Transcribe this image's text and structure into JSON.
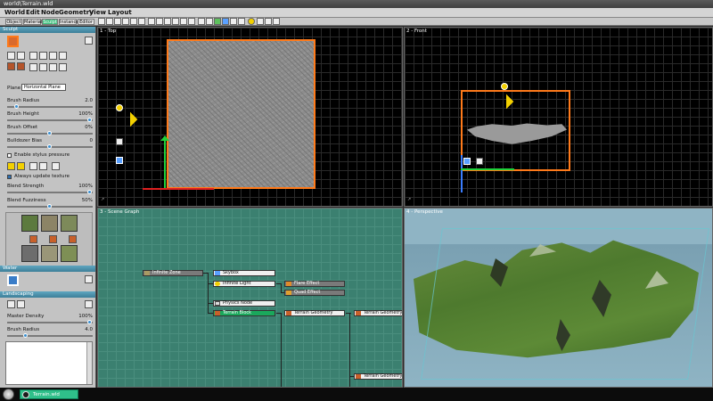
{
  "window": {
    "title": "world\\Terrain.wld"
  },
  "menu": [
    "World",
    "Edit",
    "Node",
    "Geometry",
    "View",
    "Layout"
  ],
  "tabs": [
    {
      "label": "Object",
      "active": false
    },
    {
      "label": "Material",
      "active": false
    },
    {
      "label": "Sculpt",
      "active": true
    },
    {
      "label": "Instance",
      "active": false
    },
    {
      "label": "Editor",
      "active": false
    }
  ],
  "sidebar": {
    "sculpt_header": "Sculpt",
    "plane_label": "Plane",
    "plane_value": "Horizontal Plane",
    "brush_radius": {
      "label": "Brush Radius",
      "value": "2.0",
      "level": 0.1
    },
    "brush_height": {
      "label": "Brush Height",
      "value": "100%",
      "level": 1.0
    },
    "brush_offset": {
      "label": "Brush Offset",
      "value": "0%",
      "level": 0.5
    },
    "bulldozer_bias": {
      "label": "Bulldozer Bias",
      "value": "0",
      "level": 0.5
    },
    "stylus": "Enable stylus pressure",
    "always_update": "Always update texture",
    "blend_strength": {
      "label": "Blend Strength",
      "value": "100%",
      "level": 1.0
    },
    "blend_fuzziness": {
      "label": "Blend Fuzziness",
      "value": "50%",
      "level": 0.5
    },
    "water_header": "Water",
    "landscaping_header": "Landscaping",
    "master_density": {
      "label": "Master Density",
      "value": "100%",
      "level": 1.0
    },
    "brush_radius2": {
      "label": "Brush Radius",
      "value": "4.0",
      "level": 0.2
    }
  },
  "viewports": {
    "top": "1 - Top",
    "front": "2 - Front",
    "scene_graph": "3 - Scene Graph",
    "perspective": "4 - Perspective"
  },
  "scene_graph": {
    "nodes": [
      {
        "id": "infinite-zone",
        "label": "Infinite Zone"
      },
      {
        "id": "skybox",
        "label": "Skybox"
      },
      {
        "id": "infinite-light",
        "label": "Infinite Light"
      },
      {
        "id": "flare-effect",
        "label": "Flare Effect"
      },
      {
        "id": "quad-effect",
        "label": "Quad Effect"
      },
      {
        "id": "physics-node",
        "label": "Physics Node"
      },
      {
        "id": "terrain-block",
        "label": "Terrain Block"
      },
      {
        "id": "terrain-geometry-1",
        "label": "Terrain Geometry"
      },
      {
        "id": "terrain-geometry-2",
        "label": "Terrain Geometry"
      },
      {
        "id": "terrain-geometry-3",
        "label": "Terrain Geometry"
      }
    ]
  },
  "taskbar": {
    "item": "Terrain.wld"
  },
  "colors": {
    "selection": "#ff7a1a",
    "accent": "#2fbf8a",
    "scene_bg": "#3b8070",
    "sky": "#8fb4c4",
    "grass": "#4e7a2e"
  }
}
